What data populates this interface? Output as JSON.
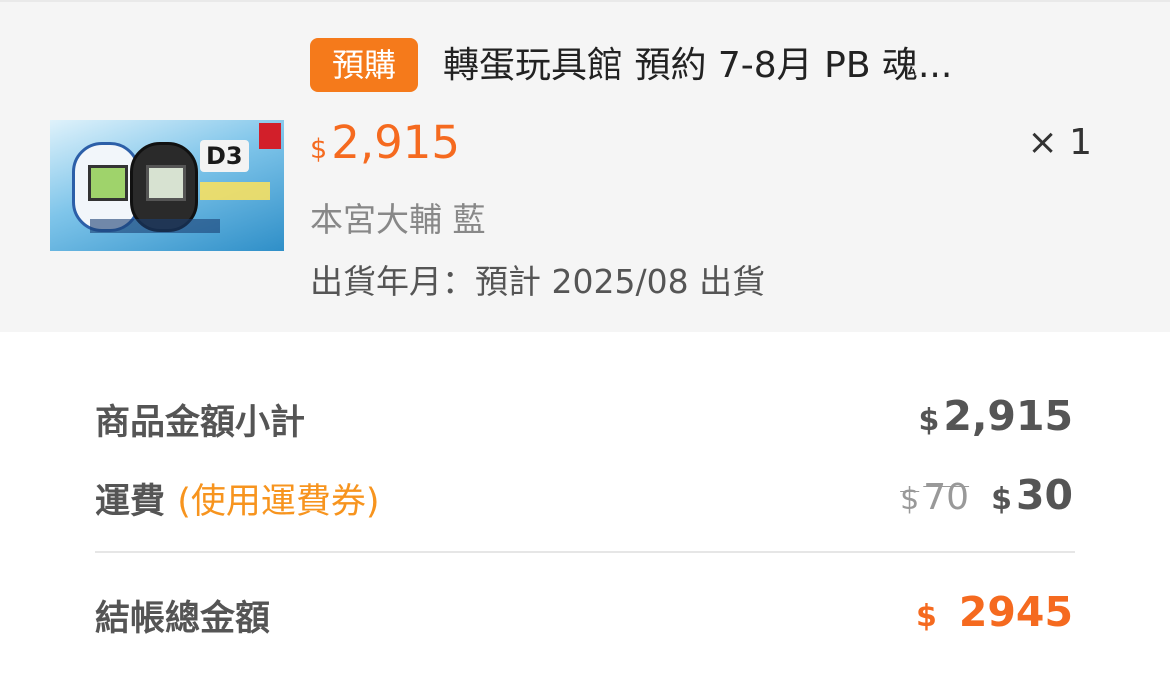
{
  "product": {
    "badge": "預購",
    "title": "轉蛋玩具館 預約 7-8月 PB 魂...",
    "price_currency": "$",
    "price": "2,915",
    "quantity": "× 1",
    "variant": "本宮大輔 藍",
    "ship_date": "出貨年月：預計 2025/08 出貨",
    "image_icon": "product-thumbnail-image"
  },
  "summary": {
    "subtotal_label": "商品金額小計",
    "subtotal_currency": "$",
    "subtotal_value": "2,915",
    "shipping_label": "運費",
    "shipping_note": "(使用運費券)",
    "shipping_old_currency": "$",
    "shipping_old_value": "70",
    "shipping_currency": "$",
    "shipping_value": "30",
    "total_label": "結帳總金額",
    "total_currency": "$",
    "total_value": "2945"
  },
  "colors": {
    "accent": "#f56a1f",
    "badge_bg": "#f57a1b",
    "note": "#f7941e",
    "panel_bg": "#f5f5f5"
  }
}
